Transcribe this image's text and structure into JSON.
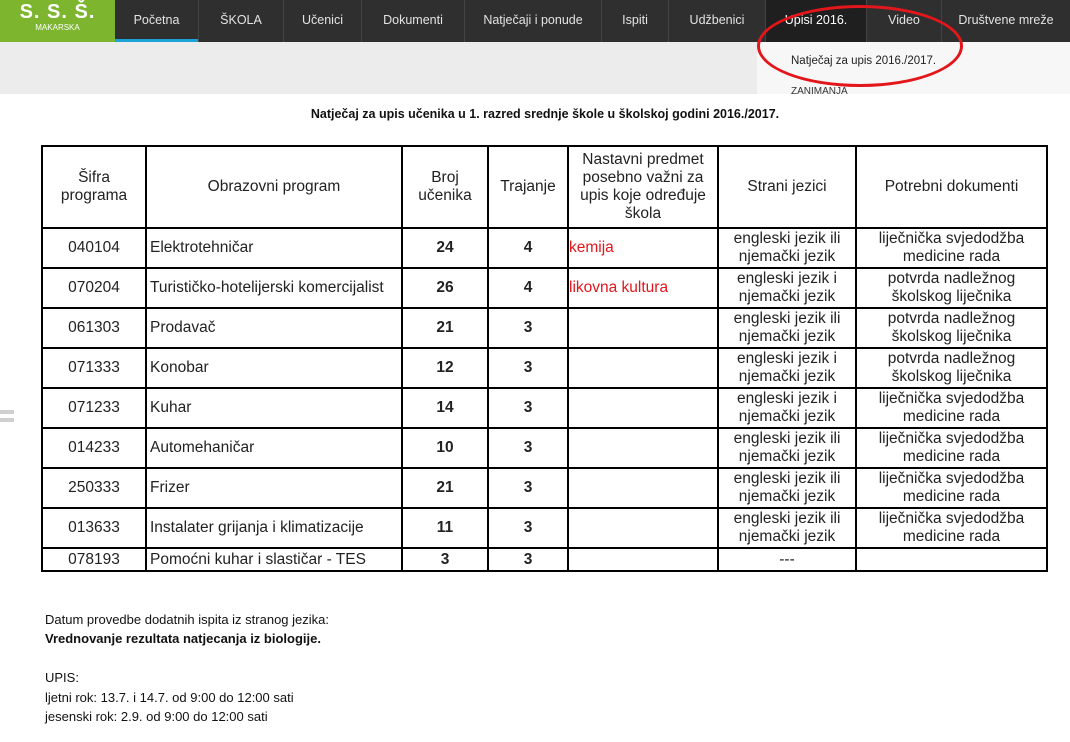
{
  "nav": {
    "logo_text": "S. S. Š.",
    "logo_sub": "MAKARSKA",
    "items": [
      "Početna",
      "ŠKOLA",
      "Učenici",
      "Dokumenti",
      "Natječaji i ponude",
      "Ispiti",
      "Udžbenici",
      "Upisi 2016.",
      "Video",
      "Društvene mreže"
    ],
    "dropdown": [
      "Natječaj za upis 2016./2017.",
      "ZANIMANJA"
    ]
  },
  "page_title": "Natječaj za upis učenika u 1. razred srednje škole u školskoj godini 2016./2017.",
  "table": {
    "headers": [
      "Šifra programa",
      "Obrazovni program",
      "Broj učenika",
      "Trajanje",
      "Nastavni predmet posebno važni za upis koje određuje škola",
      "Strani jezici",
      "Potrebni dokumenti"
    ],
    "rows": [
      {
        "code": "040104",
        "program": "Elektrotehničar",
        "students": "24",
        "duration": "4",
        "subject": "kemija",
        "languages": "engleski jezik ili njemački jezik",
        "documents": "liječnička svjedodžba medicine rada"
      },
      {
        "code": "070204",
        "program": "Turističko-hotelijerski komercijalist",
        "students": "26",
        "duration": "4",
        "subject": "likovna kultura",
        "languages": "engleski jezik i njemački jezik",
        "documents": "potvrda nadležnog školskog liječnika"
      },
      {
        "code": "061303",
        "program": "Prodavač",
        "students": "21",
        "duration": "3",
        "subject": "",
        "languages": "engleski jezik ili njemački jezik",
        "documents": "potvrda nadležnog školskog liječnika"
      },
      {
        "code": "071333",
        "program": "Konobar",
        "students": "12",
        "duration": "3",
        "subject": "",
        "languages": "engleski jezik i njemački jezik",
        "documents": "potvrda nadležnog školskog liječnika"
      },
      {
        "code": "071233",
        "program": "Kuhar",
        "students": "14",
        "duration": "3",
        "subject": "",
        "languages": "engleski jezik i njemački jezik",
        "documents": "liječnička svjedodžba medicine rada"
      },
      {
        "code": "014233",
        "program": "Automehaničar",
        "students": "10",
        "duration": "3",
        "subject": "",
        "languages": "engleski jezik ili njemački jezik",
        "documents": "liječnička svjedodžba medicine rada"
      },
      {
        "code": "250333",
        "program": "Frizer",
        "students": "21",
        "duration": "3",
        "subject": "",
        "languages": "engleski jezik ili njemački jezik",
        "documents": "liječnička svjedodžba medicine rada"
      },
      {
        "code": "013633",
        "program": "Instalater grijanja i klimatizacije",
        "students": "11",
        "duration": "3",
        "subject": "",
        "languages": "engleski jezik ili njemački jezik",
        "documents": "liječnička svjedodžba medicine rada"
      },
      {
        "code": "078193",
        "program": "Pomoćni kuhar i slastičar - TES",
        "students": "3",
        "duration": "3",
        "subject": "",
        "languages": "---",
        "documents": ""
      }
    ]
  },
  "notes": {
    "exam_date": "Datum provedbe dodatnih ispita iz stranog jezika:",
    "evaluation": "Vrednovanje rezultata natjecanja iz biologije.",
    "upis_heading": "UPIS:",
    "summer": "ljetni rok: 13.7. i 14.7. od 9:00 do 12:00 sati",
    "autumn": "jesenski rok: 2.9. od 9:00 do 12:00 sati"
  },
  "colors": {
    "nav_bg": "#2f2f2f",
    "logo_green": "#7db52f",
    "accent_blue": "#1ba3d8",
    "highlight_red": "#e3161b"
  }
}
